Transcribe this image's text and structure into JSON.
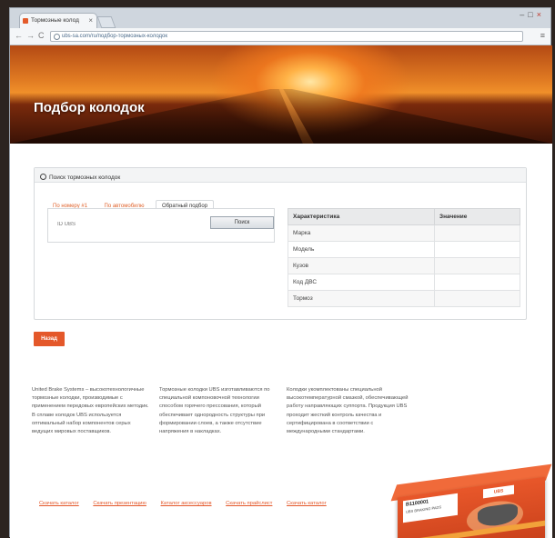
{
  "browser": {
    "tab_title": "Тормозные колод",
    "tab_close": "×",
    "url": "ubs-sa.com/ru/подбор-тормозных-колодок",
    "nav_back": "←",
    "nav_forward": "→",
    "nav_reload": "C",
    "menu": "≡",
    "win_min": "–",
    "win_max": "□",
    "win_close": "×"
  },
  "hero": {
    "title": "Подбор колодок"
  },
  "search_panel": {
    "title": "Поиск тормозных колодок",
    "tabs": [
      {
        "label": "По номеру #1"
      },
      {
        "label": "По автомобилю"
      },
      {
        "label": "Обратный подбор"
      }
    ],
    "input_placeholder": "ID UBS",
    "search_button": "Поиск"
  },
  "characteristics_table": {
    "headers": [
      "Характеристика",
      "Значение"
    ],
    "rows": [
      {
        "name": "Марка",
        "value": ""
      },
      {
        "name": "Модель",
        "value": ""
      },
      {
        "name": "Кузов",
        "value": ""
      },
      {
        "name": "Код ДВС",
        "value": ""
      },
      {
        "name": "Тормоз",
        "value": ""
      }
    ]
  },
  "reset_button": "Назад",
  "footer": {
    "col1": "United Brake Systems – высокотехнологичные тормозные колодки, производимые с применением передовых европейских методик. В сплаве колодок UBS используется оптимальный набор компонентов серых ведущих мировых поставщиков.",
    "col2": "Тормозные колодки UBS изготавливаются по специальной компоновочной технологии способом горячего прессования, который обеспечивает однородность структуры при формировании слоев, а также отсутствие напряжения в накладках.",
    "col3": "Колодки укомплектованы специальной высокотемпературной смазкой, обеспечивающей работу направляющих суппорта. Продукция UBS проходит жесткий контроль качества и сертифицирована в соответствии с международными стандартами.",
    "links": [
      "Скачать каталог",
      "Скачать презентацию",
      "Каталог аксессуаров",
      "Скачать прайслист",
      "Скачать каталог"
    ]
  },
  "product": {
    "label_code": "B1100001",
    "label_sub": "UBS BRAKING PADS",
    "brand": "UBS"
  }
}
